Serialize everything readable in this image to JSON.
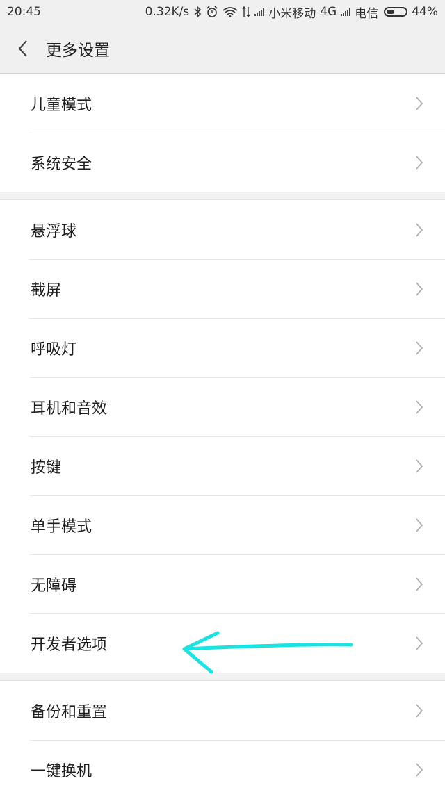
{
  "status_bar": {
    "time": "20:45",
    "speed": "0.32K/s",
    "carrier1": "小米移动",
    "network": "4G",
    "carrier2": "电信",
    "battery": "44%",
    "battery_level": 0.44
  },
  "header": {
    "title": "更多设置",
    "back_icon": "chevron-left-icon"
  },
  "groups": [
    {
      "items": [
        {
          "label": "儿童模式"
        },
        {
          "label": "系统安全"
        }
      ]
    },
    {
      "items": [
        {
          "label": "悬浮球"
        },
        {
          "label": "截屏"
        },
        {
          "label": "呼吸灯"
        },
        {
          "label": "耳机和音效"
        },
        {
          "label": "按键"
        },
        {
          "label": "单手模式"
        },
        {
          "label": "无障碍"
        },
        {
          "label": "开发者选项"
        }
      ]
    },
    {
      "items": [
        {
          "label": "备份和重置"
        },
        {
          "label": "一键换机"
        }
      ]
    }
  ],
  "annotation": {
    "type": "hand-drawn-arrow",
    "color": "#19e3e3",
    "points_to": "开发者选项"
  },
  "colors": {
    "background": "#f2f2f2",
    "card": "#ffffff",
    "chevron": "#b0b0b0"
  }
}
